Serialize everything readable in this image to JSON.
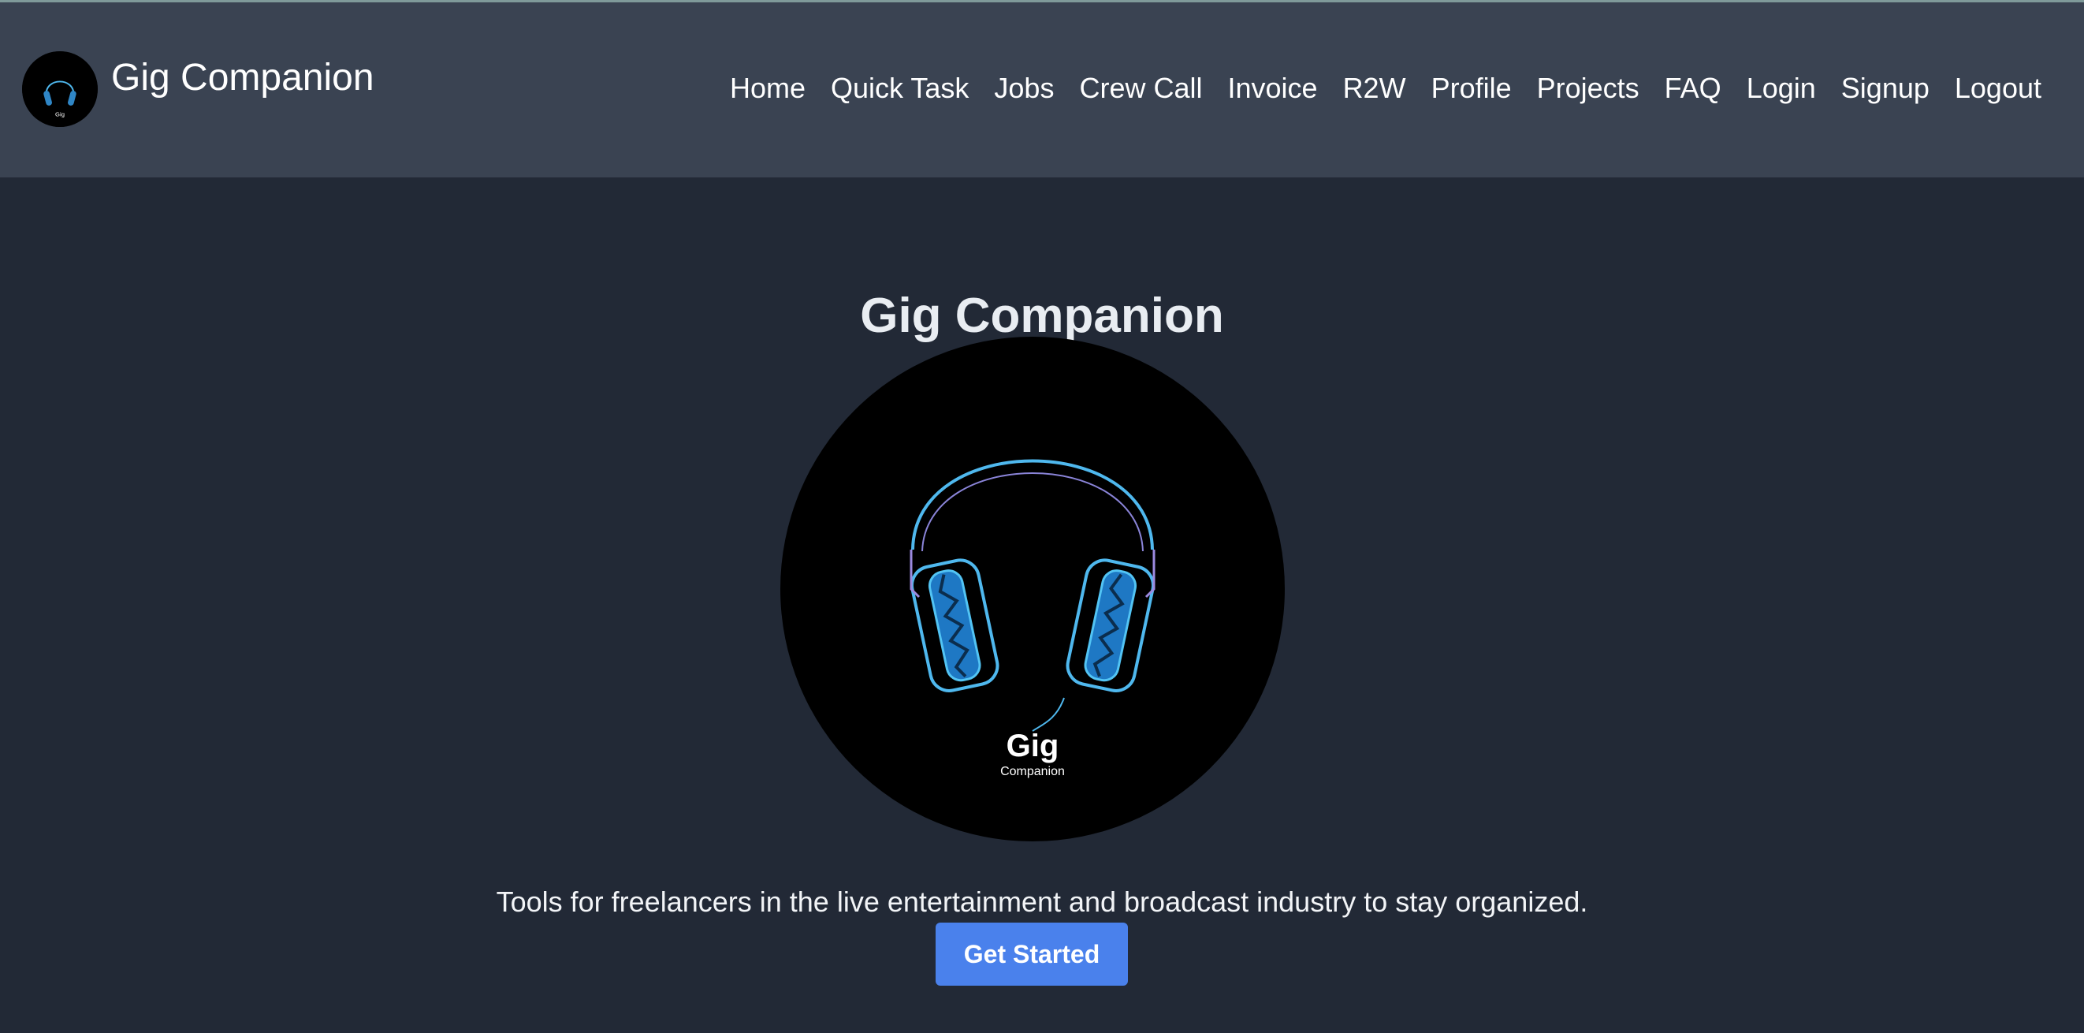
{
  "app": {
    "brand_name": "Gig Companion",
    "logo_icon": "headphones-logo-icon",
    "logo_text_main": "Gig",
    "logo_text_sub": "Companion"
  },
  "nav": {
    "items": [
      {
        "label": "Home"
      },
      {
        "label": "Quick Task"
      },
      {
        "label": "Jobs"
      },
      {
        "label": "Crew Call"
      },
      {
        "label": "Invoice"
      },
      {
        "label": "R2W"
      },
      {
        "label": "Profile"
      },
      {
        "label": "Projects"
      },
      {
        "label": "FAQ"
      },
      {
        "label": "Login"
      },
      {
        "label": "Signup"
      },
      {
        "label": "Logout"
      }
    ]
  },
  "hero": {
    "title": "Gig Companion",
    "tagline": "Tools for freelancers in the live entertainment and broadcast industry to stay organized.",
    "cta_label": "Get Started"
  },
  "colors": {
    "background": "#222936",
    "navbar": "#3a4352",
    "accent": "#4a81ec",
    "logo_line": "#4fb8ee"
  }
}
